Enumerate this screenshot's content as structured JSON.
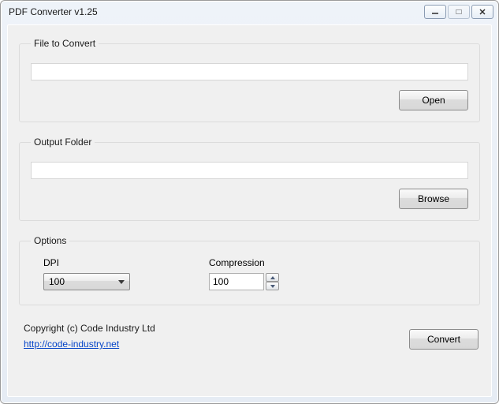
{
  "window": {
    "title": "PDF Converter v1.25"
  },
  "groups": {
    "file": {
      "legend": "File to Convert",
      "value": "",
      "open_label": "Open"
    },
    "output": {
      "legend": "Output Folder",
      "value": "",
      "browse_label": "Browse"
    },
    "options": {
      "legend": "Options",
      "dpi_label": "DPI",
      "dpi_value": "100",
      "compression_label": "Compression",
      "compression_value": "100"
    }
  },
  "footer": {
    "copyright": "Copyright (c) Code Industry Ltd",
    "link": "http://code-industry.net",
    "convert_label": "Convert"
  }
}
